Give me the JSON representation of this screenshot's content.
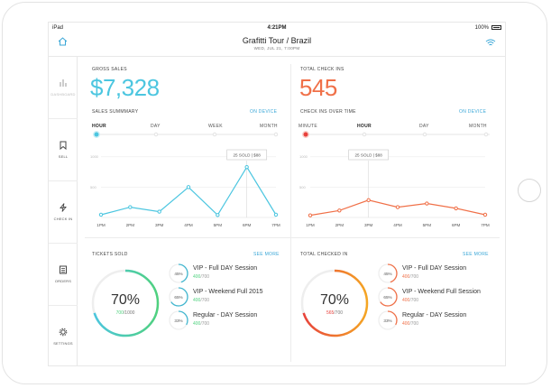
{
  "status": {
    "carrier": "iPad",
    "time": "4:21PM",
    "battery": "100%"
  },
  "header": {
    "title": "Grafitti Tour / Brazil",
    "subtitle": "WED, JUL 21, 7:00PM"
  },
  "sidebar": {
    "items": [
      {
        "label": "DASHBOARD",
        "icon": "bar-chart-icon"
      },
      {
        "label": "SELL",
        "icon": "bookmark-icon"
      },
      {
        "label": "CHECK IN",
        "icon": "lightning-icon"
      },
      {
        "label": "ORDERS",
        "icon": "list-icon"
      },
      {
        "label": "SETTINGS",
        "icon": "gear-icon"
      }
    ]
  },
  "sales": {
    "label": "GROSS SALES",
    "value": "$7,328",
    "summary_label": "SALES SUMMMARY",
    "device_link": "ON DEVICE",
    "tabs": [
      "HOUR",
      "DAY",
      "WEEK",
      "MONTH"
    ],
    "tooltip": "25 SOLD | $88"
  },
  "checkins": {
    "label": "TOTAL CHECK INS",
    "value": "545",
    "over_time_label": "CHECK INS OVER TIME",
    "device_link": "ON DEVICE",
    "tabs": [
      "MINUTE",
      "HOUR",
      "DAY",
      "MONTH"
    ],
    "tooltip": "25 SOLD | $88"
  },
  "tickets": {
    "label": "TICKETS SOLD",
    "see_more": "SEE MORE",
    "donut_pct": "70%",
    "donut_sold": "700",
    "donut_total": "/1000",
    "sessions": [
      {
        "pct": "45%",
        "name": "VIP - Full DAY Session",
        "sold": "400",
        "total": "/700"
      },
      {
        "pct": "65%",
        "name": "VIP - Weekend Full  2015",
        "sold": "400",
        "total": "/700"
      },
      {
        "pct": "33%",
        "name": "Regular - DAY Session",
        "sold": "400",
        "total": "/700"
      }
    ]
  },
  "checked": {
    "label": "TOTAL CHECKED IN",
    "see_more": "SEE MORE",
    "donut_pct": "70%",
    "donut_sold": "565",
    "donut_total": "/700",
    "sessions": [
      {
        "pct": "45%",
        "name": "VIP - Full DAY Session",
        "sold": "400",
        "total": "/700"
      },
      {
        "pct": "65%",
        "name": "VIP - Weekend Full Session",
        "sold": "400",
        "total": "/700"
      },
      {
        "pct": "33%",
        "name": "Regular - DAY Session",
        "sold": "400",
        "total": "/700"
      }
    ]
  },
  "colors": {
    "blue": "#4cc6e0",
    "orange": "#f07048",
    "green": "#4fd17e",
    "red": "#e8413c",
    "teal": "#3fb6cf"
  },
  "chart_data": [
    {
      "type": "line",
      "x": [
        "1PM",
        "2PM",
        "3PM",
        "4PM",
        "5PM",
        "6PM",
        "7PM"
      ],
      "series": [
        {
          "values": [
            90,
            340,
            190,
            1000,
            80,
            1660,
            90
          ]
        }
      ],
      "ylim": [
        0,
        2200
      ],
      "yticks": [
        {
          "label": "1000",
          "value": 2000
        },
        {
          "label": "500",
          "value": 1000
        }
      ],
      "grid": true
    },
    {
      "type": "line",
      "x": [
        "1PM",
        "2PM",
        "3PM",
        "4PM",
        "5PM",
        "6PM",
        "7PM"
      ],
      "series": [
        {
          "values": [
            70,
            230,
            570,
            340,
            460,
            300,
            90
          ]
        }
      ],
      "ylim": [
        0,
        2200
      ],
      "yticks": [
        {
          "label": "1000",
          "value": 2000
        },
        {
          "label": "500",
          "value": 1000
        }
      ],
      "grid": true
    }
  ]
}
